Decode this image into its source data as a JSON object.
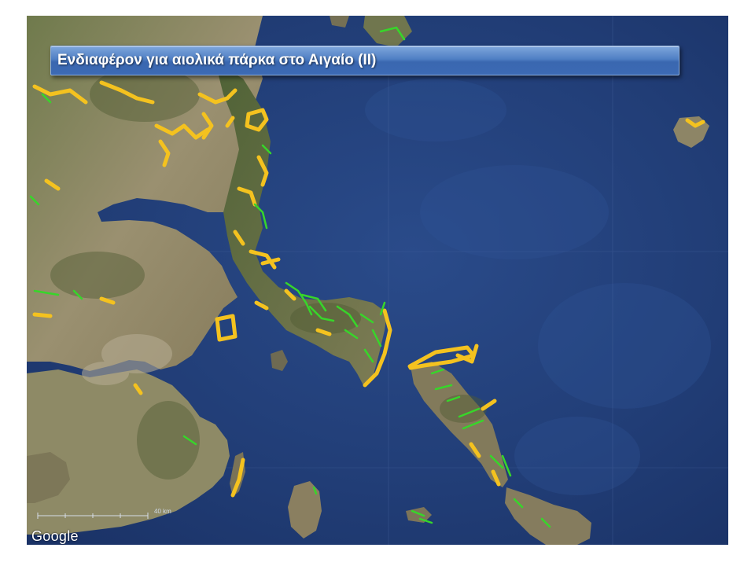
{
  "slide": {
    "title": "Ενδιαφέρον για αιολικά πάρκα στο Αιγαίο (II)"
  },
  "map": {
    "attribution": "Google",
    "scale_label": "40 km",
    "colors": {
      "sea": "#23407a",
      "land": "#8a8862",
      "interest_high": "#f4c21f",
      "interest_low": "#37d62a"
    },
    "legend_note": ""
  }
}
